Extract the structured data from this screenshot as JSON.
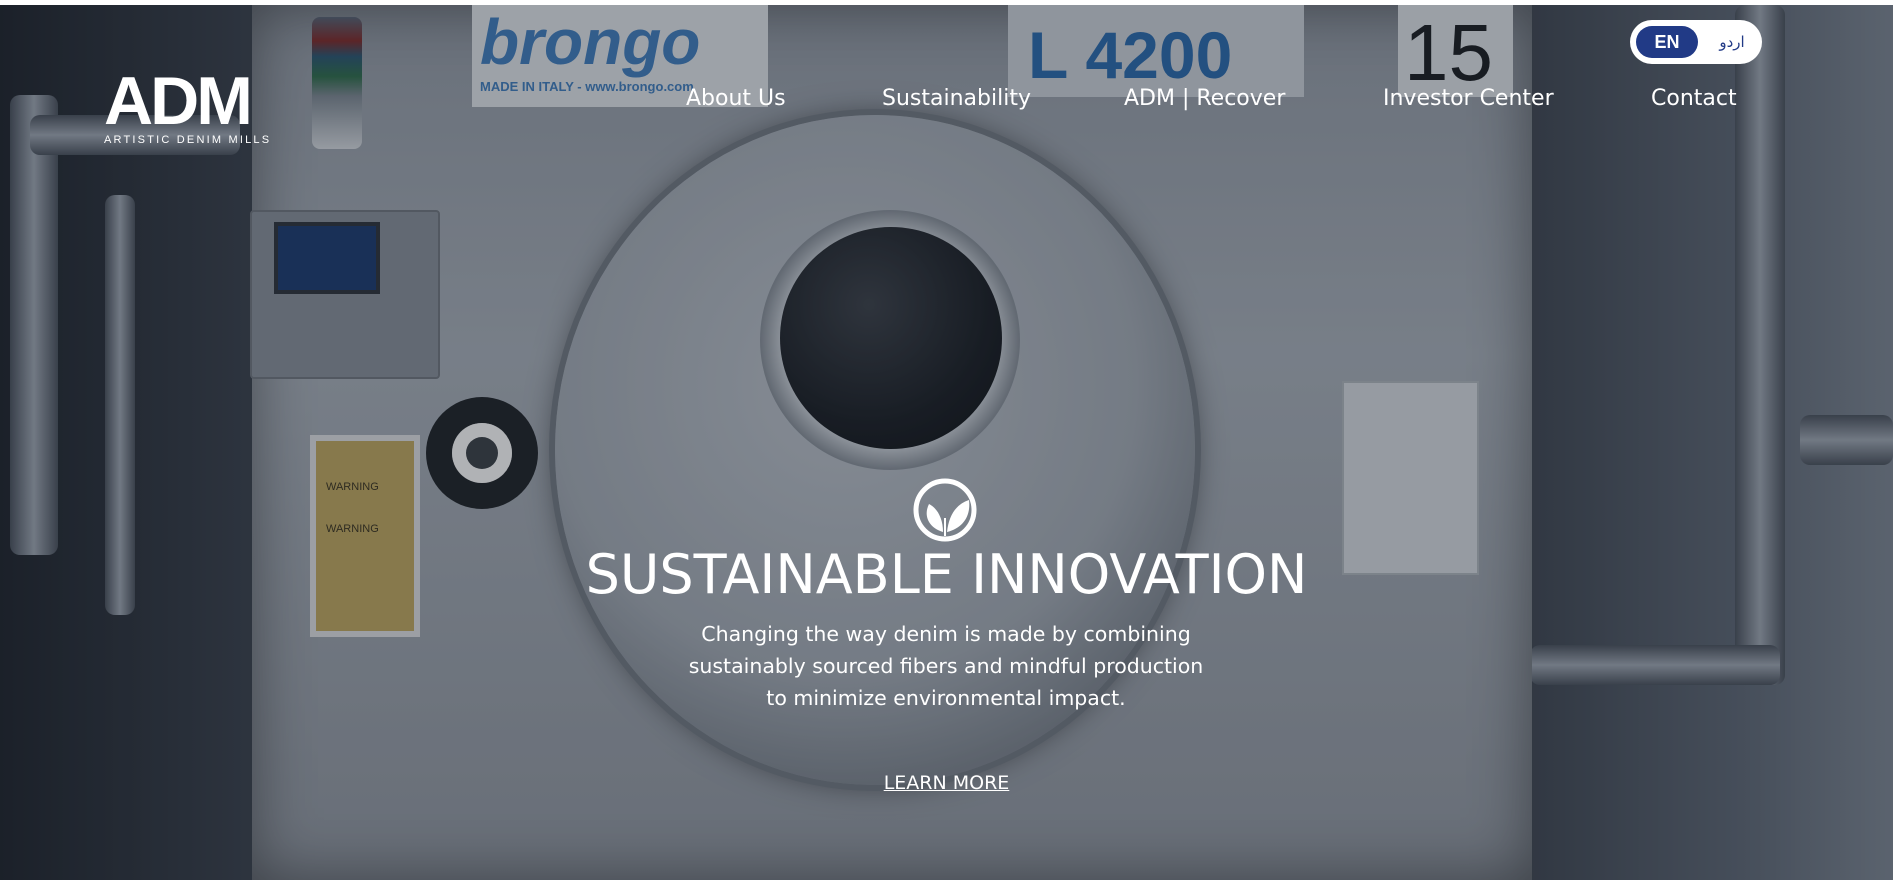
{
  "brand": {
    "logo_text": "ADM",
    "logo_subtitle": "ARTISTIC DENIM MILLS"
  },
  "nav": {
    "items": [
      {
        "label": "About Us"
      },
      {
        "label": "Sustainability"
      },
      {
        "label": "ADM | Recover"
      },
      {
        "label": "Investor Center"
      },
      {
        "label": "Contact"
      }
    ]
  },
  "language": {
    "options": [
      "EN",
      "اردو"
    ],
    "selected": "EN",
    "active_color": "#213a86"
  },
  "hero": {
    "icon": "leaf-circle-icon",
    "title": "SUSTAINABLE INNOVATION",
    "subtitle_lines": [
      "Changing the way denim is made by combining",
      "sustainably sourced fibers and mindful production",
      "to minimize environmental impact."
    ],
    "cta_label": "LEARN MORE"
  },
  "background_signs": {
    "brand": "brongo",
    "brand_tag": "MADE IN ITALY - www.brongo.com",
    "model": "L 4200",
    "number": "15",
    "warnings": [
      "WARNING",
      "WARNING"
    ]
  }
}
